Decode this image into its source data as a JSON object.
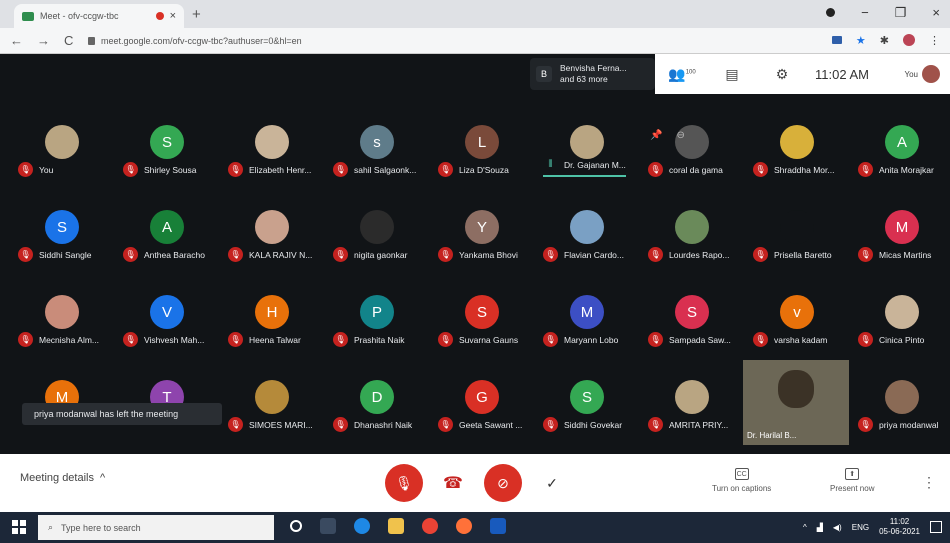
{
  "browser": {
    "tab_title": "Meet - ofv-ccgw-tbc",
    "tab_close": "×",
    "new_tab": "+",
    "url": "meet.google.com/ofv-ccgw-tbc?authuser=0&hl=en",
    "nav": {
      "back": "←",
      "forward": "→",
      "reload": "C"
    },
    "window": {
      "minimize": "−",
      "restore": "❐",
      "close": "×"
    }
  },
  "header": {
    "presenter_badge": "B",
    "presenter_text": "Benvisha Ferna...",
    "presenter_more": "and 63 more",
    "participants_icon": "👥",
    "participants_count": "100",
    "chat_icon": "▤",
    "activities_icon": "⚙",
    "clock": "11:02 AM",
    "self_label": "You"
  },
  "participants": [
    {
      "name": "You",
      "initial": "",
      "color": "#b9a582",
      "photo": true
    },
    {
      "name": "Shirley Sousa",
      "initial": "S",
      "color": "#34a853"
    },
    {
      "name": "Elizabeth Henr...",
      "initial": "",
      "color": "#c9b499",
      "photo": true
    },
    {
      "name": "sahil Salgaonk...",
      "initial": "s",
      "color": "#5f7c8a"
    },
    {
      "name": "Liza D'Souza",
      "initial": "L",
      "color": "#7a4a3a"
    },
    {
      "name": "Dr. Gajanan M...",
      "initial": "",
      "color": "#b9a582",
      "photo": true,
      "active": true
    },
    {
      "name": "coral da gama",
      "initial": "",
      "color": "#555",
      "photo": true
    },
    {
      "name": "Shraddha Mor...",
      "initial": "",
      "color": "#d8b03a",
      "photo": true
    },
    {
      "name": "Anita Morajkar",
      "initial": "A",
      "color": "#34a853"
    },
    {
      "name": "Siddhi Sangle",
      "initial": "S",
      "color": "#1a73e8"
    },
    {
      "name": "Anthea Baracho",
      "initial": "A",
      "color": "#188038"
    },
    {
      "name": "KALA RAJIV N...",
      "initial": "",
      "color": "#c9a18d",
      "photo": true
    },
    {
      "name": "nigita gaonkar",
      "initial": "",
      "color": "#2b2b2b",
      "photo": true
    },
    {
      "name": "Yankama Bhovi",
      "initial": "Y",
      "color": "#8d6e63"
    },
    {
      "name": "Flavian Cardo...",
      "initial": "",
      "color": "#7aa0c4",
      "photo": true
    },
    {
      "name": "Lourdes Rapo...",
      "initial": "",
      "color": "#6a8a5a",
      "photo": true
    },
    {
      "name": "Prisella Baretto",
      "initial": "",
      "color": "#111417",
      "photo": true
    },
    {
      "name": "Micas Martins",
      "initial": "M",
      "color": "#d93050"
    },
    {
      "name": "Mecnisha Alm...",
      "initial": "",
      "color": "#c98c7a",
      "photo": true
    },
    {
      "name": "Vishvesh Mah...",
      "initial": "V",
      "color": "#1a73e8"
    },
    {
      "name": "Heena Talwar",
      "initial": "H",
      "color": "#e8710a"
    },
    {
      "name": "Prashita Naik",
      "initial": "P",
      "color": "#12848a"
    },
    {
      "name": "Suvarna Gauns",
      "initial": "S",
      "color": "#d93025"
    },
    {
      "name": "Maryann Lobo",
      "initial": "M",
      "color": "#3c4fc4"
    },
    {
      "name": "Sampada Saw...",
      "initial": "S",
      "color": "#d93050"
    },
    {
      "name": "varsha kadam",
      "initial": "v",
      "color": "#e8710a"
    },
    {
      "name": "Cinica Pinto",
      "initial": "",
      "color": "#c9b499",
      "photo": true
    },
    {
      "name": "",
      "initial": "M",
      "color": "#e8710a",
      "hidden_name": true
    },
    {
      "name": "",
      "initial": "T",
      "color": "#8e44ad",
      "hidden_name": true
    },
    {
      "name": "SIMOES MARI...",
      "initial": "",
      "color": "#b58a3a",
      "photo": true
    },
    {
      "name": "Dhanashri Naik",
      "initial": "D",
      "color": "#34a853"
    },
    {
      "name": "Geeta Sawant ...",
      "initial": "G",
      "color": "#d93025"
    },
    {
      "name": "Siddhi Govekar",
      "initial": "S",
      "color": "#34a853"
    },
    {
      "name": "AMRITA PRIY...",
      "initial": "",
      "color": "#b9a582",
      "photo": true
    },
    {
      "name": "Dr. Harilal B...",
      "initial": "",
      "color": "#6c6756",
      "video": true
    },
    {
      "name": "priya modanwal",
      "initial": "",
      "color": "#8a6a55",
      "photo": true
    }
  ],
  "toast": "priya modanwal has left the meeting",
  "bottom": {
    "meeting_details": "Meeting details",
    "meeting_details_chev": "^",
    "mic": "🎙",
    "hangup": "☎",
    "camera": "⊘",
    "check": "✓",
    "captions_label": "Turn on captions",
    "captions_icon": "CC",
    "present_label": "Present now",
    "present_icon": "⬆",
    "more": "⋮"
  },
  "taskbar": {
    "search_placeholder": "Type here to search",
    "lang": "ENG",
    "time": "11:02",
    "date": "05-06-2021"
  }
}
